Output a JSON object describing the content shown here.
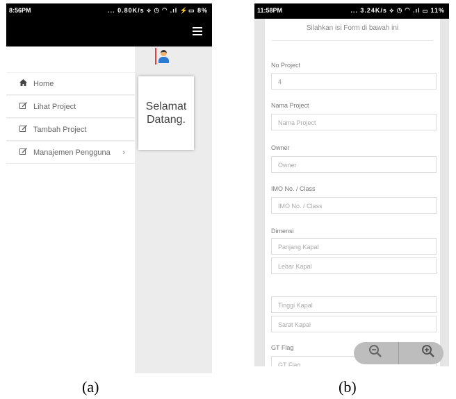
{
  "panel_a": {
    "status": {
      "time": "8:56PM",
      "icons": "... 0.80K/s ⟡ ◷ ◠ .ıl ⚡▭ 8%"
    },
    "menu": [
      {
        "label": "Home",
        "icon": "home-icon"
      },
      {
        "label": "Lihat Project",
        "icon": "edit-icon"
      },
      {
        "label": "Tambah Project",
        "icon": "edit-icon"
      },
      {
        "label": "Manajemen Pengguna",
        "icon": "edit-icon",
        "has_submenu": true
      }
    ],
    "welcome": {
      "line1": "Selamat",
      "line2": "Datang."
    }
  },
  "panel_b": {
    "status": {
      "time": "11:58PM",
      "icons": "... 3.24K/s ⟡ ◷ ◠ .ıl ▭ 11%"
    },
    "form_title": "Silahkan isi Form di bawah ini",
    "fields": {
      "no_project": {
        "label": "No Project",
        "value": "4"
      },
      "nama_project": {
        "label": "Nama Project",
        "placeholder": "Nama Project"
      },
      "owner": {
        "label": "Owner",
        "placeholder": "Owner"
      },
      "imo": {
        "label": "IMO No. / Class",
        "placeholder": "IMO No. / Class"
      },
      "dimensi": {
        "label": "Dimensi"
      },
      "panjang": {
        "placeholder": "Panjang Kapal"
      },
      "lebar": {
        "placeholder": "Lebar Kapal"
      },
      "tinggi": {
        "placeholder": "Tinggi Kapal"
      },
      "sarat": {
        "placeholder": "Sarat Kapal"
      },
      "gt_flag": {
        "label": "GT Flag",
        "placeholder": "GT Flag"
      }
    }
  },
  "captions": {
    "a": "(a)",
    "b": "(b)"
  }
}
